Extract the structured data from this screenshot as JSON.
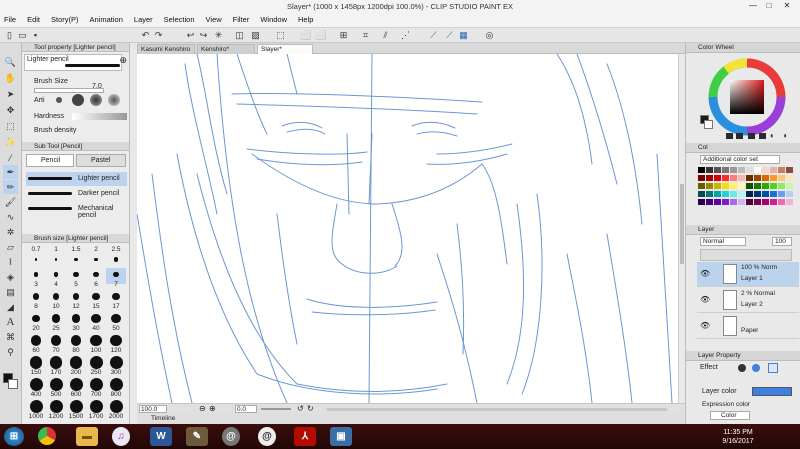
{
  "window": {
    "title": "Slayer* (1000 x 1458px 1200dpi 100.0%) - CLIP STUDIO PAINT EX",
    "minimize": "—",
    "maximize": "□",
    "close": "✕"
  },
  "menu": [
    "File",
    "Edit",
    "Story(P)",
    "Animation",
    "Layer",
    "Selection",
    "View",
    "Filter",
    "Window",
    "Help"
  ],
  "tool_property": {
    "header": "Tool property [Lighter pencil]",
    "brush_name": "Lighter pencil",
    "brush_size_label": "Brush Size",
    "brush_size_value": "7.0",
    "artist_label": "Arti",
    "hardness_label": "Hardness",
    "brush_density_label": "Brush density"
  },
  "sub_tool": {
    "header": "Sub Tool [Pencil]",
    "tabs": [
      "Pencil",
      "Pastel"
    ],
    "items": [
      "Lighter pencil",
      "Darker pencil",
      "Mechanical pencil"
    ],
    "active_index": 0
  },
  "brush_size": {
    "header": "Brush size [Lighter pencil]",
    "sizes": [
      "0.7",
      "1",
      "1.5",
      "2",
      "2.5",
      "3",
      "4",
      "5",
      "6",
      "7",
      "8",
      "10",
      "12",
      "15",
      "17",
      "20",
      "25",
      "30",
      "40",
      "50",
      "60",
      "70",
      "80",
      "100",
      "120",
      "150",
      "170",
      "200",
      "250",
      "300",
      "400",
      "500",
      "600",
      "700",
      "800",
      "1000",
      "1200",
      "1500",
      "1700",
      "2000"
    ],
    "selected": "7"
  },
  "doc_tabs": [
    {
      "label": "Kasumi Kenshiro"
    },
    {
      "label": "Kenshiro*"
    },
    {
      "label": "Slayer*",
      "active": true
    }
  ],
  "status": {
    "zoom": "100.0",
    "rotation": "0.0"
  },
  "timeline_tab": "Timeline",
  "color_wheel": {
    "header": "Color Wheel",
    "main_color": "#1b1b1b",
    "sub_color": "#ffffff"
  },
  "color_set": {
    "tab_label": "Col",
    "set_name": "Additional color set"
  },
  "layers": {
    "tab_label": "Layer",
    "blend_mode": "Normal",
    "opacity": "100",
    "items": [
      {
        "name": "Layer 1",
        "mode": "100 % Norm",
        "selected": true
      },
      {
        "name": "Layer 2",
        "mode": "2 % Normal",
        "selected": false
      },
      {
        "name": "Paper",
        "mode": "",
        "selected": false
      }
    ]
  },
  "layer_property": {
    "header": "Layer Property",
    "effect_label": "Effect",
    "layer_color_label": "Layer color",
    "layer_color": "#3f7fe0",
    "expression_color_label": "Expression color",
    "expression_color_value": "Color"
  },
  "taskbar": {
    "time": "11:35 PM",
    "date": "9/16/2017",
    "apps": [
      "start",
      "chrome",
      "folder",
      "itunes",
      "word",
      "paint",
      "clip-studio",
      "clip-studio-paint",
      "acrobat",
      "media"
    ]
  },
  "colors": {
    "accent": "#3f7fe0",
    "sketch": "#4f86c9"
  }
}
